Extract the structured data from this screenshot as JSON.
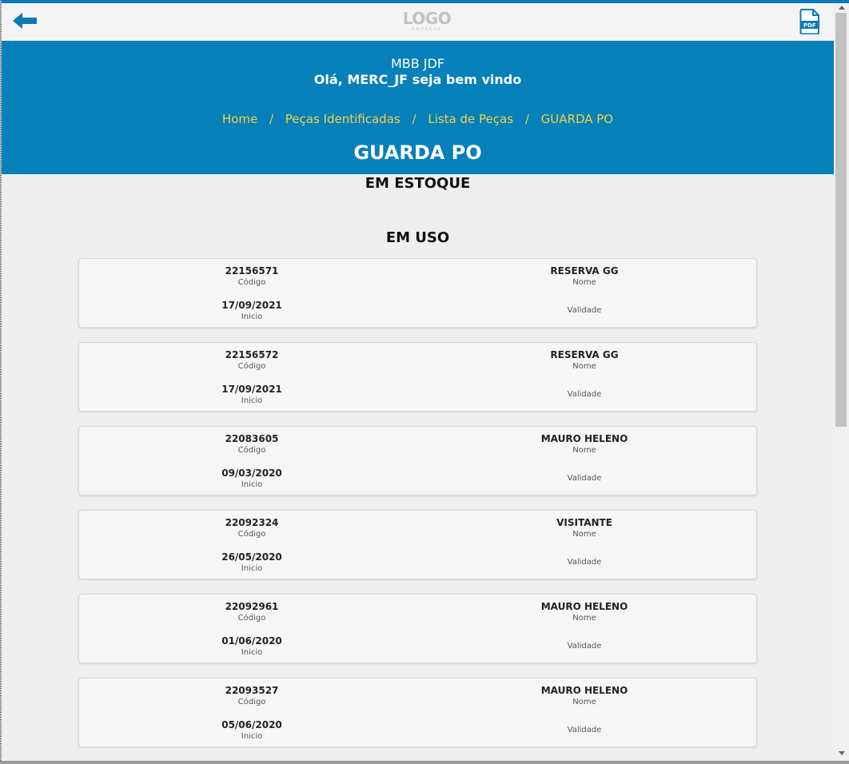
{
  "topbar": {
    "back_icon": "arrow-left-icon",
    "logo_text": "LOGO",
    "logo_subtext": "EMPRESA",
    "pdf_icon": "pdf-file-icon",
    "pdf_label": "PDF"
  },
  "header": {
    "org": "MBB JDF",
    "greeting": "Olá, MERC_JF seja bem vindo",
    "breadcrumb": [
      "Home",
      "Peças Identificadas",
      "Lista de Peças",
      "GUARDA PO"
    ],
    "separator": "/",
    "title": "GUARDA PO"
  },
  "sections": {
    "stock_title": "EM ESTOQUE",
    "in_use_title": "EM USO"
  },
  "labels": {
    "code": "Código",
    "name": "Nome",
    "start": "Inicio",
    "validity": "Validade"
  },
  "items": [
    {
      "code": "22156571",
      "name": "RESERVA GG",
      "start": "17/09/2021",
      "validity": ""
    },
    {
      "code": "22156572",
      "name": "RESERVA GG",
      "start": "17/09/2021",
      "validity": ""
    },
    {
      "code": "22083605",
      "name": "MAURO HELENO",
      "start": "09/03/2020",
      "validity": ""
    },
    {
      "code": "22092324",
      "name": "VISITANTE",
      "start": "26/05/2020",
      "validity": ""
    },
    {
      "code": "22092961",
      "name": "MAURO HELENO",
      "start": "01/06/2020",
      "validity": ""
    },
    {
      "code": "22093527",
      "name": "MAURO HELENO",
      "start": "05/06/2020",
      "validity": ""
    }
  ],
  "colors": {
    "brand_blue": "#0680b8",
    "breadcrumb_yellow": "#f0d24a"
  }
}
